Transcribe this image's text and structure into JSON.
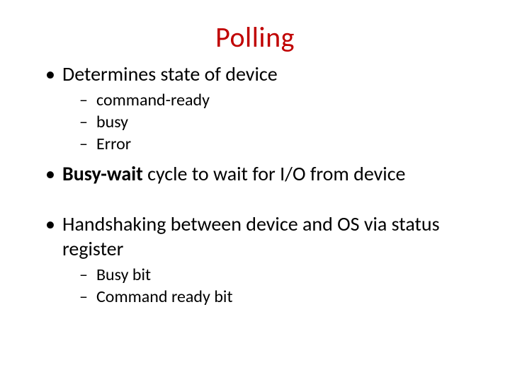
{
  "title": "Polling",
  "bullets": {
    "b1": "Determines state of device",
    "b1_sub": {
      "s1": "command-ready",
      "s2": "busy",
      "s3": "Error"
    },
    "b2_bold": "Busy-wait",
    "b2_rest": " cycle to wait for I/O from device",
    "b3": "Handshaking between device and OS via status register",
    "b3_sub": {
      "s1": "Busy bit",
      "s2": "Command ready bit"
    }
  }
}
